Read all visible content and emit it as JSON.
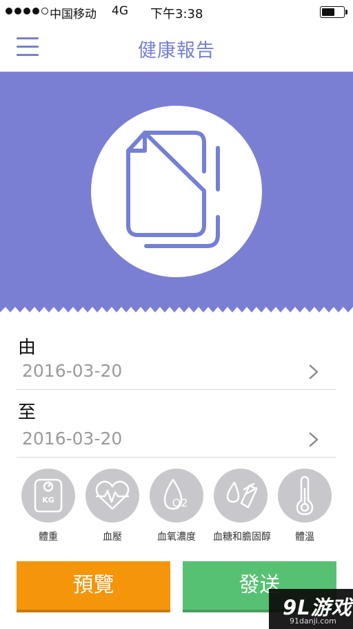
{
  "status_bar": {
    "carrier": "中国移动",
    "network": "4G",
    "time": "下午3:38",
    "signal_bars_filled": 4,
    "signal_bars_total": 5,
    "battery_level": 0.6
  },
  "nav": {
    "title": "健康報告",
    "menu_icon": "hamburger-menu-icon"
  },
  "hero": {
    "background_color": "#7b7fd4",
    "icon": "document-copy-icon"
  },
  "form": {
    "from_label": "由",
    "from_date": "2016-03-20",
    "to_label": "至",
    "to_date": "2016-03-20"
  },
  "categories": [
    {
      "label": "體重",
      "icon": "weight-scale-icon",
      "icon_text": "KG"
    },
    {
      "label": "血壓",
      "icon": "heart-pulse-icon"
    },
    {
      "label": "血氧濃度",
      "icon": "oxygen-drop-icon",
      "icon_text": "O2"
    },
    {
      "label": "血糖和膽固醇",
      "icon": "blood-sugar-icon"
    },
    {
      "label": "體溫",
      "icon": "thermometer-icon"
    }
  ],
  "actions": {
    "preview_label": "預覽",
    "send_label": "發送",
    "preview_color": "#f5950a",
    "send_color": "#57c173"
  },
  "watermark": {
    "logo": "9L游戏",
    "url": "91danji.com"
  }
}
